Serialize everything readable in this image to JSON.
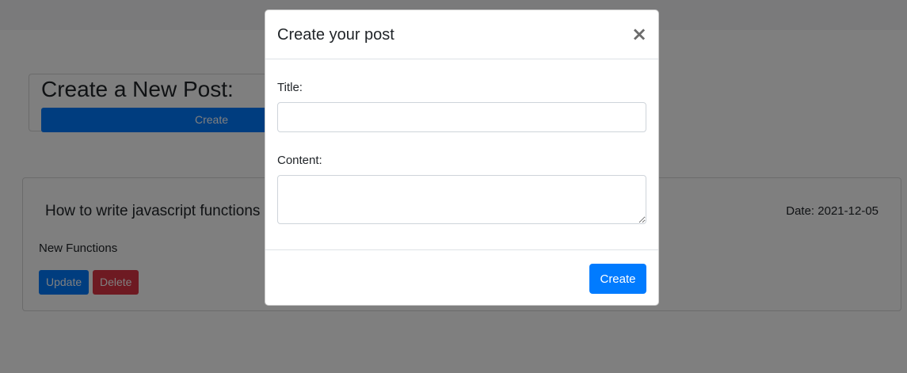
{
  "page": {
    "create_card": {
      "heading": "Create a New Post:",
      "button_label": "Create"
    },
    "post": {
      "title": "How to write javascript functions",
      "date": "Date: 2021-12-05",
      "body": "New Functions",
      "update_label": "Update",
      "delete_label": "Delete"
    }
  },
  "modal": {
    "title": "Create your post",
    "close_glyph": "×",
    "title_label": "Title:",
    "title_value": "",
    "content_label": "Content:",
    "content_value": "",
    "create_label": "Create"
  },
  "colors": {
    "primary": "#007bff",
    "danger": "#dc3545",
    "backdrop": "rgba(0,0,0,0.5)"
  }
}
